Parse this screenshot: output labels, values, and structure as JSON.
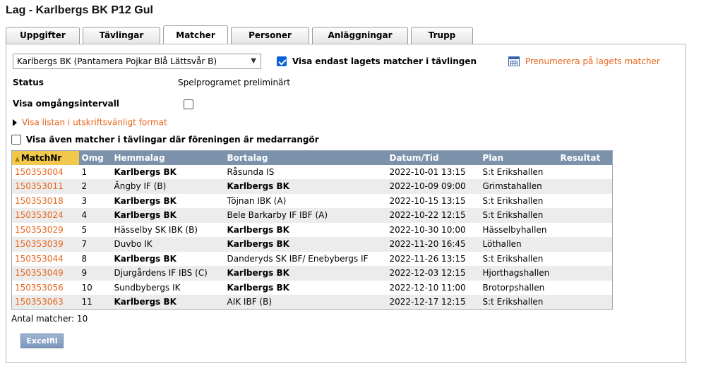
{
  "page": {
    "title": "Lag - Karlbergs BK P12 Gul"
  },
  "tabs": [
    {
      "label": "Uppgifter",
      "active": false
    },
    {
      "label": "Tävlingar",
      "active": false
    },
    {
      "label": "Matcher",
      "active": true
    },
    {
      "label": "Personer",
      "active": false
    },
    {
      "label": "Anläggningar",
      "active": false
    },
    {
      "label": "Trupp",
      "active": false
    }
  ],
  "filters": {
    "team_select": "Karlbergs BK (Pantamera Pojkar Blå Lättsvår B)",
    "only_team_label": "Visa endast lagets matcher i tävlingen",
    "only_team_checked": true,
    "subscribe_label": "Prenumerera på lagets matcher",
    "status_label": "Status",
    "status_value": "Spelprogramet preliminärt",
    "round_interval_label": "Visa omgångsintervall",
    "round_interval_checked": false,
    "print_link": "Visa listan i utskriftsvänligt format",
    "organizer_label": "Visa även matcher i tävlingar där föreningen är medarrangör",
    "organizer_checked": false
  },
  "table": {
    "headers": [
      "MatchNr",
      "Omg",
      "Hemmalag",
      "Bortalag",
      "Datum/Tid",
      "Plan",
      "Resultat"
    ],
    "rows": [
      {
        "nr": "150353004",
        "omg": "1",
        "home": "Karlbergs BK",
        "away": "Råsunda IS",
        "date": "2022-10-01 13:15",
        "plan": "S:t Erikshallen",
        "result": "",
        "home_bold": true
      },
      {
        "nr": "150353011",
        "omg": "2",
        "home": "Ängby IF (B)",
        "away": "Karlbergs BK",
        "date": "2022-10-09 09:00",
        "plan": "Grimstahallen",
        "result": "",
        "home_bold": false
      },
      {
        "nr": "150353018",
        "omg": "3",
        "home": "Karlbergs BK",
        "away": "Töjnan IBK (A)",
        "date": "2022-10-15 13:15",
        "plan": "S:t Erikshallen",
        "result": "",
        "home_bold": true
      },
      {
        "nr": "150353024",
        "omg": "4",
        "home": "Karlbergs BK",
        "away": "Bele Barkarby IF IBF (A)",
        "date": "2022-10-22 12:15",
        "plan": "S:t Erikshallen",
        "result": "",
        "home_bold": true
      },
      {
        "nr": "150353029",
        "omg": "5",
        "home": "Hässelby SK IBK (B)",
        "away": "Karlbergs BK",
        "date": "2022-10-30 10:00",
        "plan": "Hässelbyhallen",
        "result": "",
        "home_bold": false
      },
      {
        "nr": "150353039",
        "omg": "7",
        "home": "Duvbo IK",
        "away": "Karlbergs BK",
        "date": "2022-11-20 16:45",
        "plan": "Löthallen",
        "result": "",
        "home_bold": false
      },
      {
        "nr": "150353044",
        "omg": "8",
        "home": "Karlbergs BK",
        "away": "Danderyds SK IBF/ Enebybergs IF",
        "date": "2022-11-26 13:15",
        "plan": "S:t Erikshallen",
        "result": "",
        "home_bold": true
      },
      {
        "nr": "150353049",
        "omg": "9",
        "home": "Djurgårdens IF IBS (C)",
        "away": "Karlbergs BK",
        "date": "2022-12-03 12:15",
        "plan": "Hjorthagshallen",
        "result": "",
        "home_bold": false
      },
      {
        "nr": "150353056",
        "omg": "10",
        "home": "Sundbybergs IK",
        "away": "Karlbergs BK",
        "date": "2022-12-10 11:00",
        "plan": "Brotorpshallen",
        "result": "",
        "home_bold": false
      },
      {
        "nr": "150353063",
        "omg": "11",
        "home": "Karlbergs BK",
        "away": "AIK IBF (B)",
        "date": "2022-12-17 12:15",
        "plan": "S:t Erikshallen",
        "result": "",
        "home_bold": true
      }
    ]
  },
  "footer": {
    "count_text": "Antal matcher: 10",
    "excel_label": "Excelfil"
  },
  "colors": {
    "accent_orange": "#e8651b",
    "header_blue": "#7b92aa",
    "sorted_header": "#f1c84b"
  },
  "icons": {
    "calendar": "calendar-icon",
    "triangle": "triangle-right-icon",
    "sort": "sort-asc-icon"
  }
}
